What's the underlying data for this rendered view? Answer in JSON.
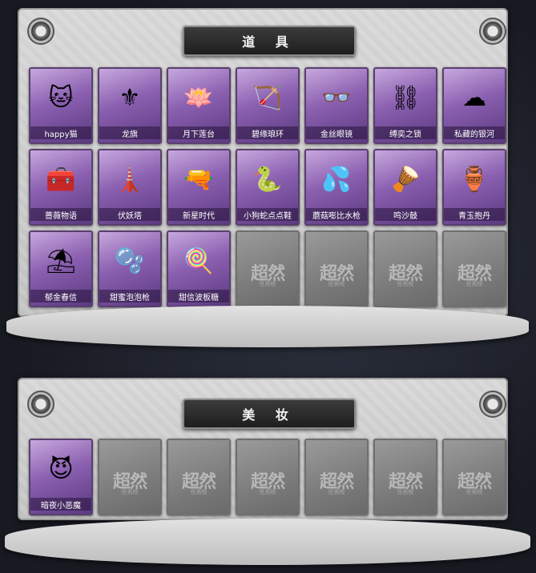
{
  "sections": {
    "props": {
      "title": "道 具",
      "items": [
        {
          "label": "happy猫",
          "icon": "cat-figurine-icon",
          "art": "🐱"
        },
        {
          "label": "龙旗",
          "icon": "golden-shovel-icon",
          "art": "⚜"
        },
        {
          "label": "月下莲台",
          "icon": "lotus-scepter-icon",
          "art": "🪷"
        },
        {
          "label": "碧缘琅环",
          "icon": "jade-bow-icon",
          "art": "🏹"
        },
        {
          "label": "金丝眼镜",
          "icon": "glasses-icon",
          "art": "👓"
        },
        {
          "label": "缚奕之锁",
          "icon": "chain-lock-icon",
          "art": "⛓"
        },
        {
          "label": "私藏的银河",
          "icon": "galaxy-cloud-icon",
          "art": "☁"
        },
        {
          "label": "蔷薇物语",
          "icon": "first-aid-case-icon",
          "art": "🧰"
        },
        {
          "label": "伏妖塔",
          "icon": "pagoda-icon",
          "art": "🗼"
        },
        {
          "label": "新星时代",
          "icon": "revolver-icon",
          "art": "🔫"
        },
        {
          "label": "小狗蛇点点鞋",
          "icon": "snake-toy-icon",
          "art": "🐍"
        },
        {
          "label": "蘑菇嘭比水枪",
          "icon": "water-gun-icon",
          "art": "💦"
        },
        {
          "label": "鸣沙鼓",
          "icon": "dreamcatcher-icon",
          "art": "🪘"
        },
        {
          "label": "青玉抱丹",
          "icon": "jade-gourd-icon",
          "art": "🏺"
        },
        {
          "label": "郁金春信",
          "icon": "parasol-icon",
          "art": "⛱"
        },
        {
          "label": "甜蜜泡泡枪",
          "icon": "bubble-gun-icon",
          "art": "🫧"
        },
        {
          "label": "甜信波板糖",
          "icon": "lollipop-wand-icon",
          "art": "🍭"
        }
      ],
      "empty_count": 4
    },
    "makeup": {
      "title": "美 妆",
      "items": [
        {
          "label": "暗夜小恶魔",
          "icon": "devil-head-icon",
          "art": "😈"
        }
      ],
      "empty_count": 6
    }
  },
  "watermark": {
    "main": "超然",
    "sub": "任务榜"
  },
  "colors": {
    "slot_purple": "#8a5fb0",
    "banner_dark": "#2a2a2a",
    "empty_gray": "#7b7b7b"
  }
}
